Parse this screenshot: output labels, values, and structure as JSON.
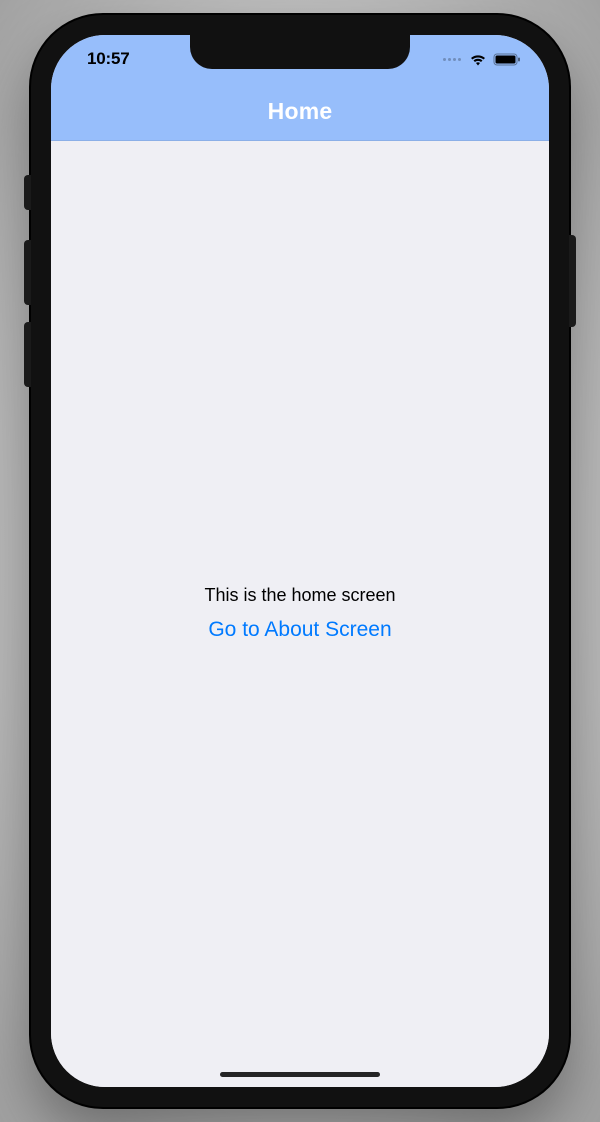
{
  "status_bar": {
    "time": "10:57"
  },
  "nav": {
    "title": "Home"
  },
  "content": {
    "body_text": "This is the home screen",
    "link_label": "Go to About Screen"
  },
  "colors": {
    "header_bg": "#97befb",
    "content_bg": "#efeff4",
    "link": "#007aff"
  }
}
